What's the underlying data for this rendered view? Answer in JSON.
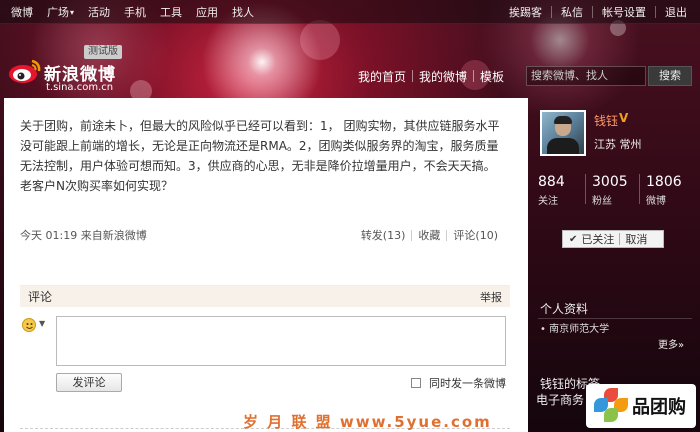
{
  "topnav": {
    "left": [
      {
        "label": "微博"
      },
      {
        "label": "广场",
        "caret": "▾"
      },
      {
        "label": "活动"
      },
      {
        "label": "手机"
      },
      {
        "label": "工具"
      },
      {
        "label": "应用"
      },
      {
        "label": "找人"
      }
    ],
    "right": [
      {
        "label": "挨踢客"
      },
      {
        "label": "私信"
      },
      {
        "label": "帐号设置"
      },
      {
        "label": "退出"
      }
    ]
  },
  "logo": {
    "name": "新浪微博",
    "url": "t.sina.com.cn",
    "beta": "测试版"
  },
  "mainnav": {
    "home": "我的首页",
    "weibo": "我的微博",
    "template": "模板"
  },
  "search": {
    "placeholder": "搜索微博、找人",
    "button": "搜索"
  },
  "post": {
    "text": "关于团购，前途未卜，但最大的风险似乎已经可以看到：1， 团购实物，其供应链服务水平没可能跟上前端的增长，无论是正向物流还是RMA。2，团购类似服务界的淘宝，服务质量无法控制，用户体验可想而知。3，供应商的心思，无非是降价拉增量用户，不会天天搞。老客户N次购买率如何实现？",
    "meta": "今天  01:19 来自新浪微博",
    "repost": "转发(13)",
    "favorite": "收藏",
    "comment": "评论(10)"
  },
  "comments": {
    "title": "评论",
    "report": "举报",
    "submit": "发评论",
    "also_post": "同时发一条微博"
  },
  "user": {
    "name": "钱钰",
    "verified": "V",
    "location": "江苏  常州",
    "stats": [
      {
        "num": "884",
        "label": "关注"
      },
      {
        "num": "3005",
        "label": "粉丝"
      },
      {
        "num": "1806",
        "label": "微博"
      }
    ],
    "follow_status": "已关注",
    "cancel": "取消",
    "check": "✔"
  },
  "sidebar": {
    "profile_title": "个人资料",
    "school": "• 南京师范大学",
    "more": "更多»",
    "tags_title": "钱钰的标签",
    "tags_text": "电子商务 京师范大"
  },
  "watermarks": {
    "center": "岁 月 联 盟  www.5yue.com",
    "logo": "品团购"
  },
  "colors": {
    "accent": "#ff9966",
    "watermark": "#e07030"
  }
}
